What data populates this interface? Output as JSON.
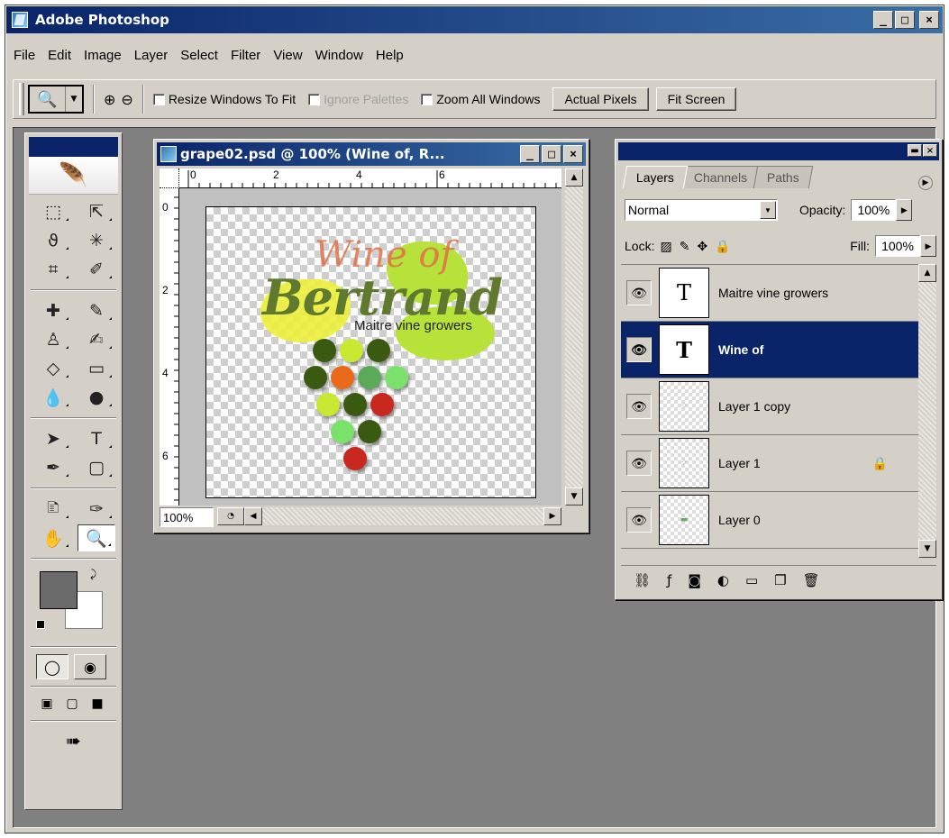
{
  "window": {
    "title": "Adobe Photoshop",
    "controls": [
      "_",
      "□",
      "×"
    ]
  },
  "menu": [
    "File",
    "Edit",
    "Image",
    "Layer",
    "Select",
    "Filter",
    "View",
    "Window",
    "Help"
  ],
  "options": {
    "resize_windows": "Resize Windows To Fit",
    "ignore_palettes": "Ignore Palettes",
    "zoom_all": "Zoom All Windows",
    "actual_pixels": "Actual Pixels",
    "fit_screen": "Fit Screen"
  },
  "document": {
    "title": "grape02.psd @ 100% (Wine of, R...",
    "zoom": "100%",
    "ruler_h": [
      "0",
      "2",
      "4",
      "6"
    ],
    "ruler_v": [
      "0",
      "2",
      "4",
      "6"
    ],
    "canvas": {
      "wine_text": "Wine of",
      "brand_text": "Bertrand",
      "tagline": "Maitre vine growers"
    },
    "grape_colors": [
      "#3a5a12",
      "#c8e832",
      "#3a5a12",
      "#3a5a12",
      "#e86a1a",
      "#5aaa5a",
      "#7ae26a",
      "#c8e832",
      "#3a5a12",
      "#c8281e",
      "#7ae26a",
      "#3a5a12",
      "#c8281e"
    ]
  },
  "layers_panel": {
    "tabs": [
      "Layers",
      "Channels",
      "Paths"
    ],
    "blend_mode": "Normal",
    "opacity_label": "Opacity:",
    "opacity_value": "100%",
    "lock_label": "Lock:",
    "fill_label": "Fill:",
    "fill_value": "100%",
    "layers": [
      {
        "name": "Maitre vine growers",
        "type": "text",
        "selected": false,
        "locked": false
      },
      {
        "name": "Wine of",
        "type": "text",
        "selected": true,
        "locked": false
      },
      {
        "name": "Layer 1 copy",
        "type": "image",
        "selected": false,
        "locked": false
      },
      {
        "name": "Layer 1",
        "type": "image",
        "selected": false,
        "locked": true
      },
      {
        "name": "Layer 0",
        "type": "image",
        "selected": false,
        "locked": false
      }
    ]
  },
  "toolbox": {
    "fg_color": "#6b6b6b",
    "bg_color": "#ffffff"
  }
}
